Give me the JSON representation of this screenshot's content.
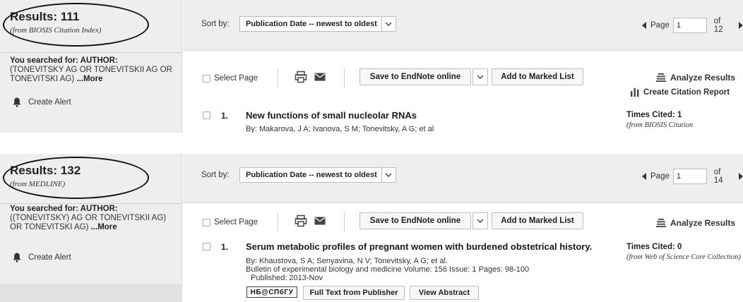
{
  "panel_a": {
    "results_title": "Results: 111",
    "results_source": "(from BIOSIS Citation Index)",
    "searched_prefix": "You searched for: AUTHOR:",
    "searched_query": "(TONEVITSKY AG OR TONEVITSKII AG OR TONEVITSKI AG) ",
    "searched_more": "...More",
    "create_alert": "Create Alert",
    "sort_label": "Sort by:",
    "sort_value": "Publication Date -- newest to oldest",
    "page_label": "Page",
    "page_value": "1",
    "page_of": "of 12",
    "select_page": "Select Page",
    "save_endnote": "Save to EndNote online",
    "add_marked": "Add to Marked List",
    "analyze": "Analyze Results",
    "citation_report": "Create Citation Report",
    "record": {
      "number": "1.",
      "title": "New functions of small nucleolar RNAs",
      "authors": "By: Makarova, J A; Ivanova, S M; Tonevitsky, A G; et al",
      "times_cited": "Times Cited: 1",
      "times_cited_source": "(from BIOSIS Citation"
    }
  },
  "panel_b": {
    "results_title": "Results: 132",
    "results_source": "(from MEDLINE)",
    "searched_prefix": "You searched for: AUTHOR:",
    "searched_query": "((TONEVITSKY) AG OR TONEVITSKII AG) OR TONEVITSKI AG) ",
    "searched_more": "...More",
    "create_alert": "Create Alert",
    "sort_label": "Sort by:",
    "sort_value": "Publication Date -- newest to oldest",
    "page_label": "Page",
    "page_value": "1",
    "page_of": "of 14",
    "select_page": "Select Page",
    "save_endnote": "Save to EndNote online",
    "add_marked": "Add to Marked List",
    "analyze": "Analyze Results",
    "record": {
      "number": "1.",
      "title": "Serum metabolic profiles of pregnant women with burdened obstetrical history.",
      "authors": "By: Khaustova, S A; Senyavina, N V; Tonevitsky, A G; et al.",
      "journal": "Bulletin of experimental biology and medicine  Volume: 156   Issue: 1   Pages: 98-100",
      "published": "Published: 2013-Nov",
      "lib_button": "НБ@СПбГУ",
      "full_text": "Full Text from Publisher",
      "view_abstract": "View Abstract",
      "times_cited": "Times Cited: 0",
      "times_cited_source": "(from Web of Science Core Collection)"
    }
  },
  "icons": [
    "bell-icon",
    "print-icon",
    "email-icon",
    "chevron-down-icon",
    "analyze-icon",
    "bar-chart-icon",
    "caret-left-icon",
    "caret-right-icon"
  ]
}
